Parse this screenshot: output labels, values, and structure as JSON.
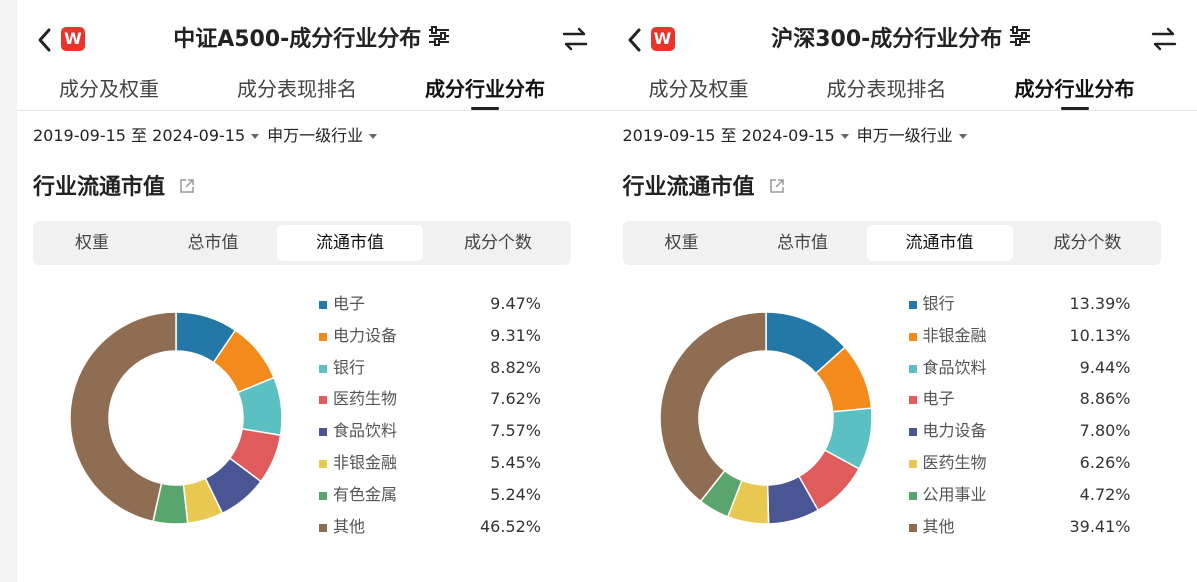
{
  "panels": [
    {
      "title": "中证A500-成分行业分布",
      "logo": "W",
      "tabs": [
        "成分及权重",
        "成分表现排名",
        "成分行业分布"
      ],
      "active_tab": 2,
      "date_range": "2019-09-15 至 2024-09-15",
      "industry_filter": "申万一级行业",
      "section_title": "行业流通市值",
      "segments": [
        "权重",
        "总市值",
        "流通市值",
        "成分个数"
      ],
      "active_segment": 2,
      "chart_data": {
        "type": "pie",
        "categories": [
          "电子",
          "电力设备",
          "银行",
          "医药生物",
          "食品饮料",
          "非银金融",
          "有色金属",
          "其他"
        ],
        "values": [
          9.47,
          9.31,
          8.82,
          7.62,
          7.57,
          5.45,
          5.24,
          46.52
        ],
        "labels": [
          "9.47%",
          "9.31%",
          "8.82%",
          "7.62%",
          "7.57%",
          "5.45%",
          "5.24%",
          "46.52%"
        ],
        "colors": [
          "#2378a8",
          "#f28a1c",
          "#5cc0c3",
          "#e05b5b",
          "#4a5693",
          "#e9c851",
          "#5aa46e",
          "#8f6d52"
        ]
      }
    },
    {
      "title": "沪深300-成分行业分布",
      "logo": "W",
      "tabs": [
        "成分及权重",
        "成分表现排名",
        "成分行业分布"
      ],
      "active_tab": 2,
      "date_range": "2019-09-15 至 2024-09-15",
      "industry_filter": "申万一级行业",
      "section_title": "行业流通市值",
      "segments": [
        "权重",
        "总市值",
        "流通市值",
        "成分个数"
      ],
      "active_segment": 2,
      "chart_data": {
        "type": "pie",
        "categories": [
          "银行",
          "非银金融",
          "食品饮料",
          "电子",
          "电力设备",
          "医药生物",
          "公用事业",
          "其他"
        ],
        "values": [
          13.39,
          10.13,
          9.44,
          8.86,
          7.8,
          6.26,
          4.72,
          39.41
        ],
        "labels": [
          "13.39%",
          "10.13%",
          "9.44%",
          "8.86%",
          "7.80%",
          "6.26%",
          "4.72%",
          "39.41%"
        ],
        "colors": [
          "#2378a8",
          "#f28a1c",
          "#5cc0c3",
          "#e05b5b",
          "#4a5693",
          "#e9c851",
          "#5aa46e",
          "#8f6d52"
        ]
      }
    }
  ]
}
